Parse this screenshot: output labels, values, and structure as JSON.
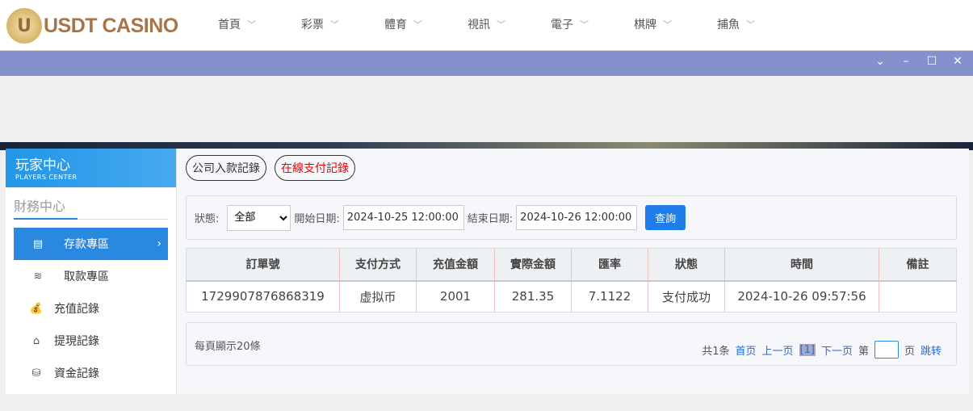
{
  "brand": {
    "logo_letter": "U",
    "name": "USDT CASINO"
  },
  "nav": [
    "首頁",
    "彩票",
    "體育",
    "視訊",
    "電子",
    "棋牌",
    "捕魚"
  ],
  "window_controls": [
    "chevron-down",
    "minimize",
    "maximize",
    "close"
  ],
  "sidebar": {
    "title": "玩家中心",
    "subtitle": "PLAYERS CENTER",
    "section": "財務中心",
    "items": [
      {
        "label": "存款專區",
        "icon": "card-icon",
        "active": true
      },
      {
        "label": "取款專區",
        "icon": "hand-money-icon"
      },
      {
        "label": "充值記錄",
        "icon": "money-bag-icon"
      },
      {
        "label": "提現記錄",
        "icon": "wallet-icon"
      },
      {
        "label": "資金記錄",
        "icon": "piggy-bank-icon"
      }
    ]
  },
  "tabs": [
    {
      "label": "公司入款記錄"
    },
    {
      "label": "在線支付記錄",
      "color": "#e00000"
    }
  ],
  "filter": {
    "status_label": "狀態:",
    "status_value": "全部",
    "start_label": "開始日期:",
    "start_value": "2024-10-25 12:00:00",
    "end_label": "結束日期:",
    "end_value": "2024-10-26 12:00:00",
    "query": "查詢"
  },
  "table": {
    "headers": [
      "訂單號",
      "支付方式",
      "充值金額",
      "實際金額",
      "匯率",
      "狀態",
      "時間",
      "備註"
    ],
    "rows": [
      [
        "1729907876868319",
        "虚拟币",
        "2001",
        "281.35",
        "7.1122",
        "支付成功",
        "2024-10-26 09:57:56",
        ""
      ]
    ]
  },
  "pager": {
    "per_page": "每頁顯示20條",
    "total": "共1条",
    "first": "首页",
    "prev": "上一页",
    "current": "[1]",
    "next": "下一页",
    "page_prefix": "第",
    "page_suffix": "页",
    "jump": "跳转"
  },
  "colors": {
    "accent": "#2a88e0",
    "titlebar": "#8591cc"
  }
}
